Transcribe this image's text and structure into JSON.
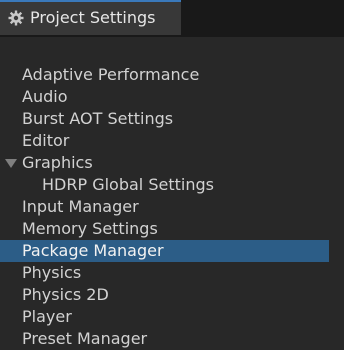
{
  "window": {
    "tab_title": "Project Settings",
    "tab_icon": "gear-icon"
  },
  "tree": {
    "selected": "Package Manager",
    "items": [
      {
        "label": "Adaptive Performance"
      },
      {
        "label": "Audio"
      },
      {
        "label": "Burst AOT Settings"
      },
      {
        "label": "Editor"
      },
      {
        "label": "Graphics",
        "expanded": true
      },
      {
        "label": "HDRP Global Settings",
        "child_of": "Graphics"
      },
      {
        "label": "Input Manager"
      },
      {
        "label": "Memory Settings"
      },
      {
        "label": "Package Manager",
        "selected": true
      },
      {
        "label": "Physics"
      },
      {
        "label": "Physics 2D"
      },
      {
        "label": "Player"
      },
      {
        "label": "Preset Manager"
      }
    ]
  },
  "colors": {
    "background": "#282828",
    "tab": "#383838",
    "tab_accent": "#3a79bb",
    "selection": "#2c5d87",
    "text": "#d2d2d2"
  }
}
